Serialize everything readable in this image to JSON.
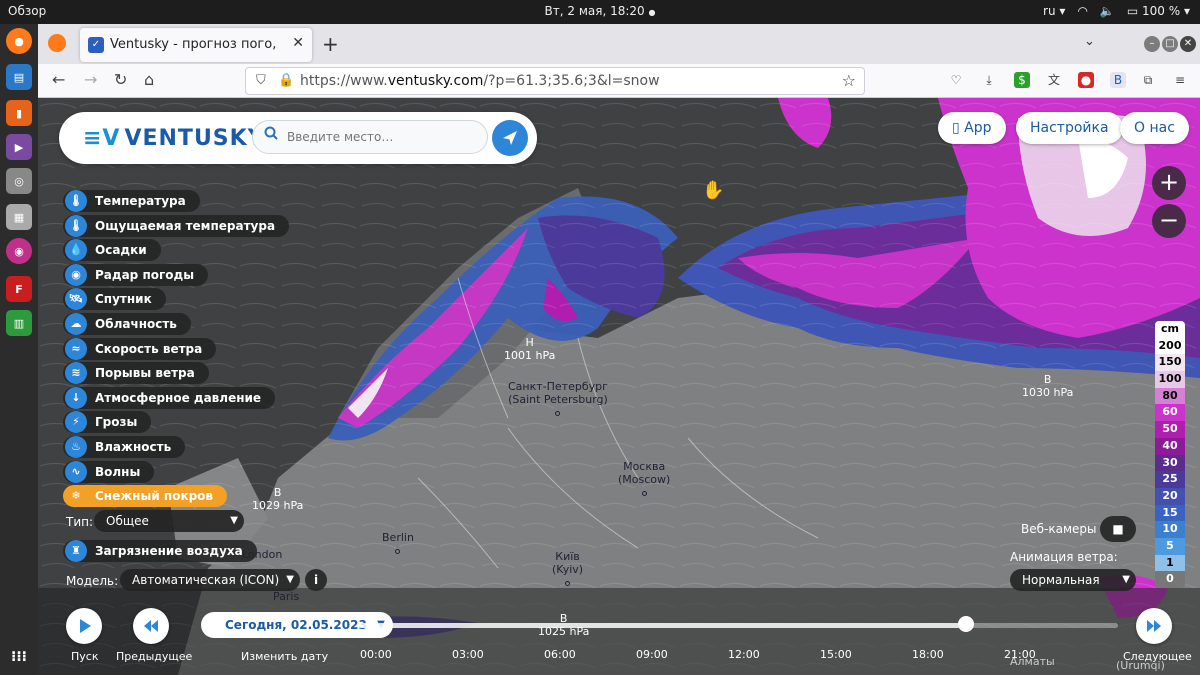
{
  "os": {
    "activities": "Обзор",
    "clock": "Вт, 2 мая, 18:20",
    "lang": "ru",
    "battery": "100 %"
  },
  "browser": {
    "tab_title": "Ventusky - прогноз пого,",
    "url_prefix": "https://www.",
    "url_domain": "ventusky.com",
    "url_rest": "/?p=61.3;35.6;3&l=snow"
  },
  "app": {
    "logo": "VENTUSKY",
    "search_placeholder": "Введите место…",
    "top_buttons": [
      "App",
      "Настройка",
      "О нас"
    ],
    "layers": [
      {
        "label": "Температура",
        "icon": "thermometer-icon",
        "glyph": "🌡"
      },
      {
        "label": "Ощущаемая температура",
        "icon": "thermometer-icon",
        "glyph": "🌡"
      },
      {
        "label": "Осадки",
        "icon": "drop-icon",
        "glyph": "💧"
      },
      {
        "label": "Радар погоды",
        "icon": "radar-icon",
        "glyph": "◉"
      },
      {
        "label": "Спутник",
        "icon": "satellite-icon",
        "glyph": "🛰"
      },
      {
        "label": "Облачность",
        "icon": "cloud-icon",
        "glyph": "☁"
      },
      {
        "label": "Скорость ветра",
        "icon": "wind-icon",
        "glyph": "≈"
      },
      {
        "label": "Порывы ветра",
        "icon": "gust-icon",
        "glyph": "≋"
      },
      {
        "label": "Атмосферное давление",
        "icon": "pressure-icon",
        "glyph": "↓"
      },
      {
        "label": "Грозы",
        "icon": "lightning-icon",
        "glyph": "⚡"
      },
      {
        "label": "Влажность",
        "icon": "humidity-icon",
        "glyph": "♨"
      },
      {
        "label": "Волны",
        "icon": "waves-icon",
        "glyph": "∿"
      },
      {
        "label": "Снежный покров",
        "icon": "snowflake-icon",
        "glyph": "❄",
        "active": true
      }
    ],
    "type_label": "Тип:",
    "type_value": "Общее",
    "pollution_label": "Загрязнение воздуха",
    "model_label": "Модель:",
    "model_value": "Автоматическая (ICON)",
    "webcams_label": "Веб-камеры",
    "wind_anim_label": "Анимация ветра:",
    "wind_anim_value": "Нормальная",
    "legend_unit": "cm",
    "legend": [
      {
        "v": "200",
        "c": "#ffffff",
        "t": "#000"
      },
      {
        "v": "150",
        "c": "#f2e6f2",
        "t": "#000"
      },
      {
        "v": "100",
        "c": "#e8c8e8",
        "t": "#000"
      },
      {
        "v": "80",
        "c": "#d67fd6",
        "t": "#000"
      },
      {
        "v": "60",
        "c": "#cc33cc",
        "t": "#fff"
      },
      {
        "v": "50",
        "c": "#b01eb0",
        "t": "#fff"
      },
      {
        "v": "40",
        "c": "#8e1a9a",
        "t": "#fff"
      },
      {
        "v": "30",
        "c": "#5a2d8c",
        "t": "#fff"
      },
      {
        "v": "25",
        "c": "#4b3a99",
        "t": "#fff"
      },
      {
        "v": "20",
        "c": "#4350b0",
        "t": "#fff"
      },
      {
        "v": "15",
        "c": "#3a62c0",
        "t": "#fff"
      },
      {
        "v": "10",
        "c": "#3a7fd0",
        "t": "#fff"
      },
      {
        "v": "5",
        "c": "#4c9be0",
        "t": "#fff"
      },
      {
        "v": "1",
        "c": "#8fc0e8",
        "t": "#000"
      },
      {
        "v": "0",
        "c": "#777777",
        "t": "#fff"
      }
    ],
    "cities": [
      {
        "name": "Санкт-Петербург",
        "sub": "(Saint Petersburg)"
      },
      {
        "name": "Москва",
        "sub": "(Moscow)"
      },
      {
        "name": "Berlin",
        "sub": ""
      },
      {
        "name": "Київ",
        "sub": "(Kyiv)"
      },
      {
        "name": "London",
        "sub": ""
      },
      {
        "name": "Paris",
        "sub": ""
      },
      {
        "name": "Алматы",
        "sub": ""
      },
      {
        "name": "(Urumqi)",
        "sub": ""
      }
    ],
    "pressure": [
      {
        "letter": "H",
        "value": "1001 hPa"
      },
      {
        "letter": "B",
        "value": "1030 hPa"
      },
      {
        "letter": "B",
        "value": "1029 hPa"
      },
      {
        "letter": "B",
        "value": "1025 hPa"
      }
    ],
    "timeline": {
      "play_label": "Пуск",
      "prev_label": "Предыдущее",
      "change_date_label": "Изменить дату",
      "next_label": "Следующее",
      "date": "Сегодня, 02.05.2023",
      "hours": [
        "00:00",
        "03:00",
        "06:00",
        "09:00",
        "12:00",
        "15:00",
        "18:00",
        "21:00"
      ],
      "progress": 0.8
    }
  }
}
